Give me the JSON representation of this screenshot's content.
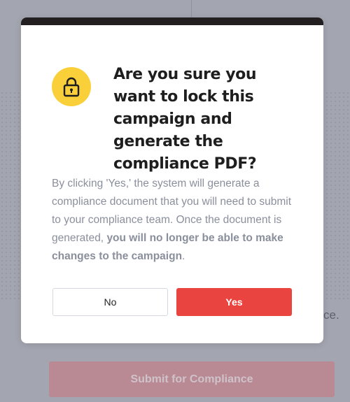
{
  "background": {
    "fragment_text": "ce.",
    "submit_label": "Submit for Compliance"
  },
  "modal": {
    "icon": "lock-icon",
    "accent_color": "#f9cf3a",
    "title": "Are you sure you want to lock this campaign and generate the compliance PDF?",
    "body_intro": "By clicking 'Yes,' the system will generate a compliance document that you will need to submit to your compliance team. Once the document is generated, ",
    "body_bold": "you will no longer be able to make changes to the campaign",
    "body_end": ".",
    "no_label": "No",
    "yes_label": "Yes",
    "yes_color": "#e9443f"
  }
}
